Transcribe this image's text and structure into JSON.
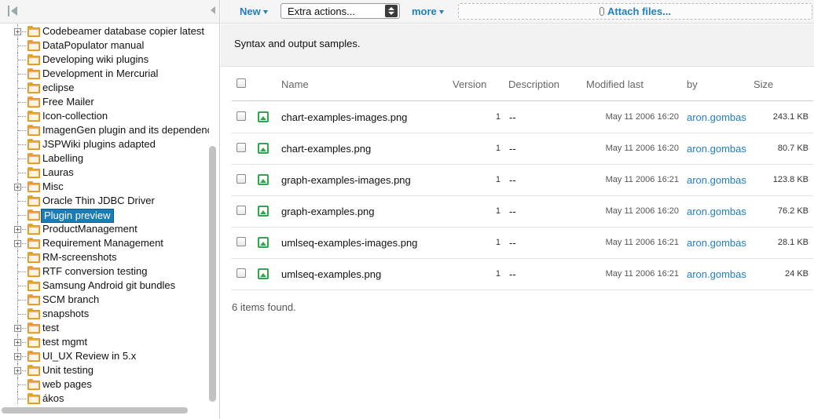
{
  "toolbar": {
    "new_label": "New",
    "extra_actions_value": "Extra actions...",
    "more_label": "more",
    "attach_label": "Attach files..."
  },
  "tree": {
    "items": [
      {
        "label": "Codebeamer database copier latest",
        "expandable": true,
        "selected": false
      },
      {
        "label": "DataPopulator manual",
        "expandable": false,
        "selected": false
      },
      {
        "label": "Developing wiki plugins",
        "expandable": false,
        "selected": false
      },
      {
        "label": "Development in Mercurial",
        "expandable": false,
        "selected": false
      },
      {
        "label": "eclipse",
        "expandable": false,
        "selected": false
      },
      {
        "label": "Free Mailer",
        "expandable": false,
        "selected": false
      },
      {
        "label": "Icon-collection",
        "expandable": false,
        "selected": false
      },
      {
        "label": "ImagenGen plugin and its dependenc",
        "expandable": false,
        "selected": false
      },
      {
        "label": "JSPWiki plugins adapted",
        "expandable": false,
        "selected": false
      },
      {
        "label": "Labelling",
        "expandable": false,
        "selected": false
      },
      {
        "label": "Lauras",
        "expandable": false,
        "selected": false
      },
      {
        "label": "Misc",
        "expandable": true,
        "selected": false
      },
      {
        "label": "Oracle Thin JDBC Driver",
        "expandable": false,
        "selected": false
      },
      {
        "label": "Plugin preview",
        "expandable": false,
        "selected": true
      },
      {
        "label": "ProductManagement",
        "expandable": true,
        "selected": false
      },
      {
        "label": "Requirement Management",
        "expandable": true,
        "selected": false
      },
      {
        "label": "RM-screenshots",
        "expandable": false,
        "selected": false
      },
      {
        "label": "RTF conversion testing",
        "expandable": false,
        "selected": false
      },
      {
        "label": "Samsung Android git bundles",
        "expandable": false,
        "selected": false
      },
      {
        "label": "SCM branch",
        "expandable": false,
        "selected": false
      },
      {
        "label": "snapshots",
        "expandable": false,
        "selected": false
      },
      {
        "label": "test",
        "expandable": true,
        "selected": false
      },
      {
        "label": "test mgmt",
        "expandable": true,
        "selected": false
      },
      {
        "label": "UI_UX Review in 5.x",
        "expandable": true,
        "selected": false
      },
      {
        "label": "Unit testing",
        "expandable": true,
        "selected": false
      },
      {
        "label": "web pages",
        "expandable": false,
        "selected": false
      },
      {
        "label": "ákos",
        "expandable": false,
        "selected": false
      }
    ]
  },
  "main": {
    "description": "Syntax and output samples.",
    "columns": {
      "name": "Name",
      "version": "Version",
      "description": "Description",
      "modified": "Modified last",
      "by": "by",
      "size": "Size"
    },
    "rows": [
      {
        "name": "chart-examples-images.png",
        "version": "1",
        "description": "--",
        "modified": "May 11 2006 16:20",
        "by": "aron.gombas",
        "size": "243.1 KB"
      },
      {
        "name": "chart-examples.png",
        "version": "1",
        "description": "--",
        "modified": "May 11 2006 16:20",
        "by": "aron.gombas",
        "size": "80.7 KB"
      },
      {
        "name": "graph-examples-images.png",
        "version": "1",
        "description": "--",
        "modified": "May 11 2006 16:21",
        "by": "aron.gombas",
        "size": "123.8 KB"
      },
      {
        "name": "graph-examples.png",
        "version": "1",
        "description": "--",
        "modified": "May 11 2006 16:20",
        "by": "aron.gombas",
        "size": "76.2 KB"
      },
      {
        "name": "umlseq-examples-images.png",
        "version": "1",
        "description": "--",
        "modified": "May 11 2006 16:21",
        "by": "aron.gombas",
        "size": "28.1 KB"
      },
      {
        "name": "umlseq-examples.png",
        "version": "1",
        "description": "--",
        "modified": "May 11 2006 16:21",
        "by": "aron.gombas",
        "size": "24 KB"
      }
    ],
    "count_text": "6 items found."
  },
  "icons": {
    "collapse": "collapse-panel-icon",
    "folder": "folder-icon",
    "file": "image-file-icon",
    "attach": "paperclip-icon"
  },
  "colors": {
    "link": "#1f7fbf",
    "selection": "#1b7db8",
    "folder": "#f7a93a",
    "file_icon": "#2ea84b"
  }
}
